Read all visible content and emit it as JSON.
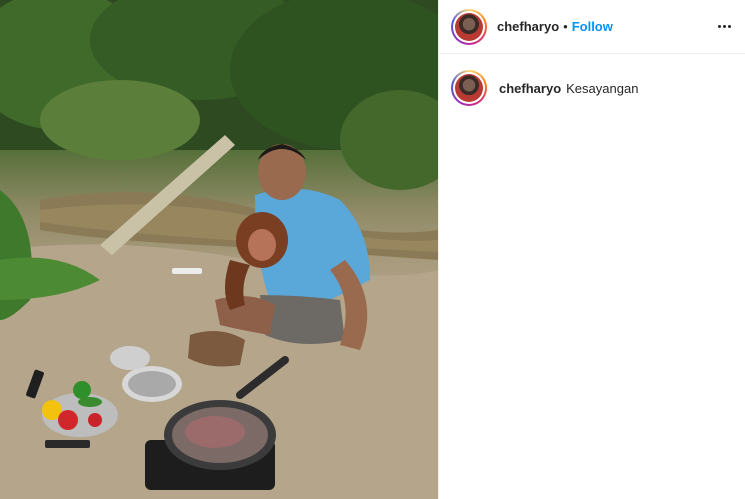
{
  "post": {
    "username": "chefharyo",
    "separator": "•",
    "follow_label": "Follow",
    "caption": {
      "username": "chefharyo",
      "text": "Kesayangan"
    },
    "more_icon": "more-horizontal-icon"
  },
  "colors": {
    "follow": "#0095f6",
    "text": "#262626",
    "border": "#efefef"
  }
}
